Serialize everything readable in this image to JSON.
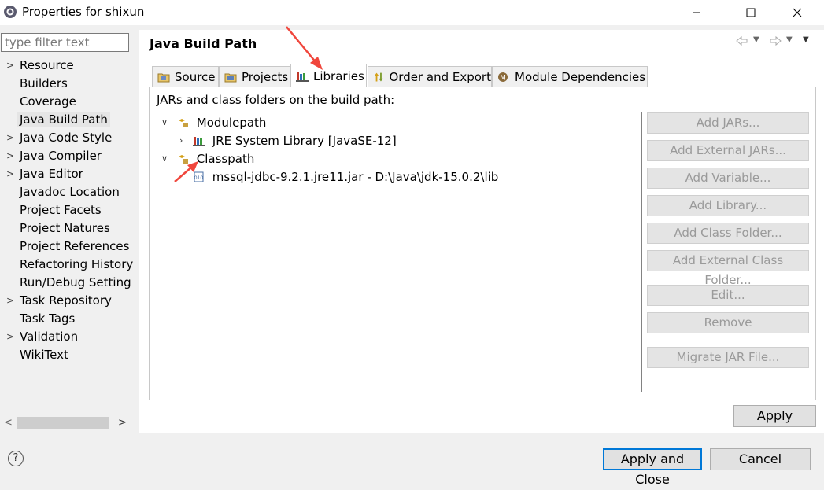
{
  "window": {
    "title": "Properties for shixun",
    "minimize_icon": "minimize-icon",
    "maximize_icon": "maximize-icon",
    "close_icon": "close-icon"
  },
  "filter": {
    "placeholder": "type filter text"
  },
  "nav": {
    "items": [
      {
        "label": "Resource",
        "expandable": true
      },
      {
        "label": "Builders",
        "expandable": false
      },
      {
        "label": "Coverage",
        "expandable": false
      },
      {
        "label": "Java Build Path",
        "expandable": false,
        "selected": true
      },
      {
        "label": "Java Code Style",
        "expandable": true
      },
      {
        "label": "Java Compiler",
        "expandable": true
      },
      {
        "label": "Java Editor",
        "expandable": true
      },
      {
        "label": "Javadoc Location",
        "expandable": false
      },
      {
        "label": "Project Facets",
        "expandable": false
      },
      {
        "label": "Project Natures",
        "expandable": false
      },
      {
        "label": "Project References",
        "expandable": false
      },
      {
        "label": "Refactoring History",
        "expandable": false
      },
      {
        "label": "Run/Debug Setting",
        "expandable": false
      },
      {
        "label": "Task Repository",
        "expandable": true
      },
      {
        "label": "Task Tags",
        "expandable": false
      },
      {
        "label": "Validation",
        "expandable": true
      },
      {
        "label": "WikiText",
        "expandable": false
      }
    ]
  },
  "page": {
    "title": "Java Build Path",
    "tabs": [
      {
        "label": "Source",
        "icon": "source-folder-icon"
      },
      {
        "label": "Projects",
        "icon": "projects-icon"
      },
      {
        "label": "Libraries",
        "icon": "libraries-icon",
        "active": true
      },
      {
        "label": "Order and Export",
        "icon": "order-export-icon"
      },
      {
        "label": "Module Dependencies",
        "icon": "module-dependencies-icon"
      }
    ],
    "section_label": "JARs and class folders on the build path:",
    "tree": {
      "modulepath": "Modulepath",
      "jre": "JRE System Library [JavaSE-12]",
      "classpath": "Classpath",
      "jar": "mssql-jdbc-9.2.1.jre11.jar - D:\\Java\\jdk-15.0.2\\lib"
    },
    "side_buttons": [
      "Add JARs...",
      "Add External JARs...",
      "Add Variable...",
      "Add Library...",
      "Add Class Folder...",
      "Add External Class Folder...",
      "Edit...",
      "Remove",
      "Migrate JAR File..."
    ],
    "apply": "Apply"
  },
  "footer": {
    "apply_and_close": "Apply and Close",
    "cancel": "Cancel"
  },
  "colors": {
    "annotation_arrow": "#f0463c",
    "focus_blue": "#0078d7"
  }
}
